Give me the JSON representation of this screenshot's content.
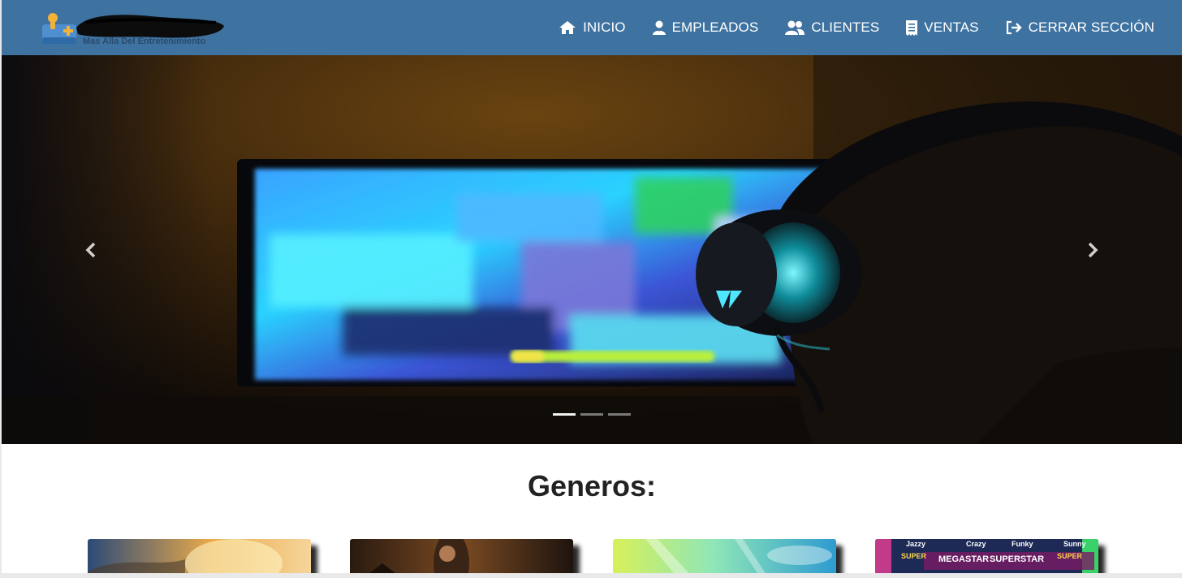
{
  "brand": {
    "tagline": "Mas Alla Del Entretenimiento",
    "logo_icon": "gamepad-joystick-icon"
  },
  "nav": {
    "items": [
      {
        "label": "INICIO",
        "icon": "home-icon"
      },
      {
        "label": "EMPLEADOS",
        "icon": "user-icon"
      },
      {
        "label": "CLIENTES",
        "icon": "users-icon"
      },
      {
        "label": "VENTAS",
        "icon": "receipt-icon"
      },
      {
        "label": "CERRAR SECCIÓN",
        "icon": "sign-out-icon"
      }
    ]
  },
  "carousel": {
    "prev_icon": "chevron-left-icon",
    "next_icon": "chevron-right-icon",
    "indicators": 3,
    "active_index": 0
  },
  "genres": {
    "title": "Generos:",
    "cards": [
      {
        "name": "genre-card-1"
      },
      {
        "name": "genre-card-2"
      },
      {
        "name": "genre-card-3"
      },
      {
        "name": "genre-card-4",
        "labels": [
          "Jazzy",
          "Crazy",
          "Funky",
          "Sunny",
          "SUPER",
          "MEGASTAR",
          "SUPERSTAR",
          "SUPER"
        ]
      }
    ]
  },
  "colors": {
    "navbar": "#3e72a0",
    "nav_text": "#ffffff",
    "title_text": "#222222"
  }
}
